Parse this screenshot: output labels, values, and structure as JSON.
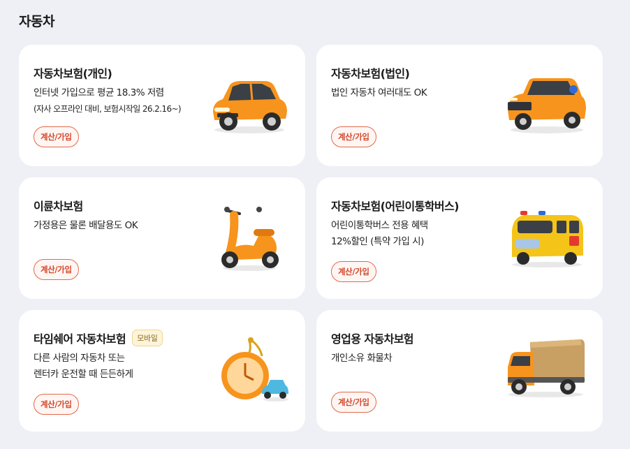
{
  "section": {
    "title": "자동차"
  },
  "button_label": "계산/가입",
  "cards": [
    {
      "title": "자동차보험(개인)",
      "lines": [
        "인터넷 가입으로 평균 18.3% 저렴",
        "(자사 오프라인 대비, 보험시작일 26.2.16~)"
      ],
      "icon": "orange-car-icon"
    },
    {
      "title": "자동차보험(법인)",
      "lines": [
        "법인 자동차 여러대도 OK"
      ],
      "icon": "orange-suv-icon"
    },
    {
      "title": "이륜차보험",
      "lines": [
        "가정용은 물론 배달용도 OK"
      ],
      "icon": "scooter-icon"
    },
    {
      "title": "자동차보험(어린이통학버스)",
      "lines": [
        "어린이통학버스 전용 혜택",
        "12%할인 (특약 가입 시)"
      ],
      "icon": "school-bus-icon"
    },
    {
      "title": "타임쉐어 자동차보험",
      "badge": "모바일",
      "lines": [
        "다른 사람의 자동차 또는",
        "렌터카 운전할 때 든든하게"
      ],
      "icon": "pocket-watch-car-icon"
    },
    {
      "title": "영업용 자동차보험",
      "lines": [
        "개인소유 화물차"
      ],
      "icon": "cargo-truck-icon"
    }
  ],
  "colors": {
    "accent": "#d2462a",
    "background": "#eef0f5",
    "card": "#ffffff",
    "illustration_orange": "#f7941d"
  }
}
